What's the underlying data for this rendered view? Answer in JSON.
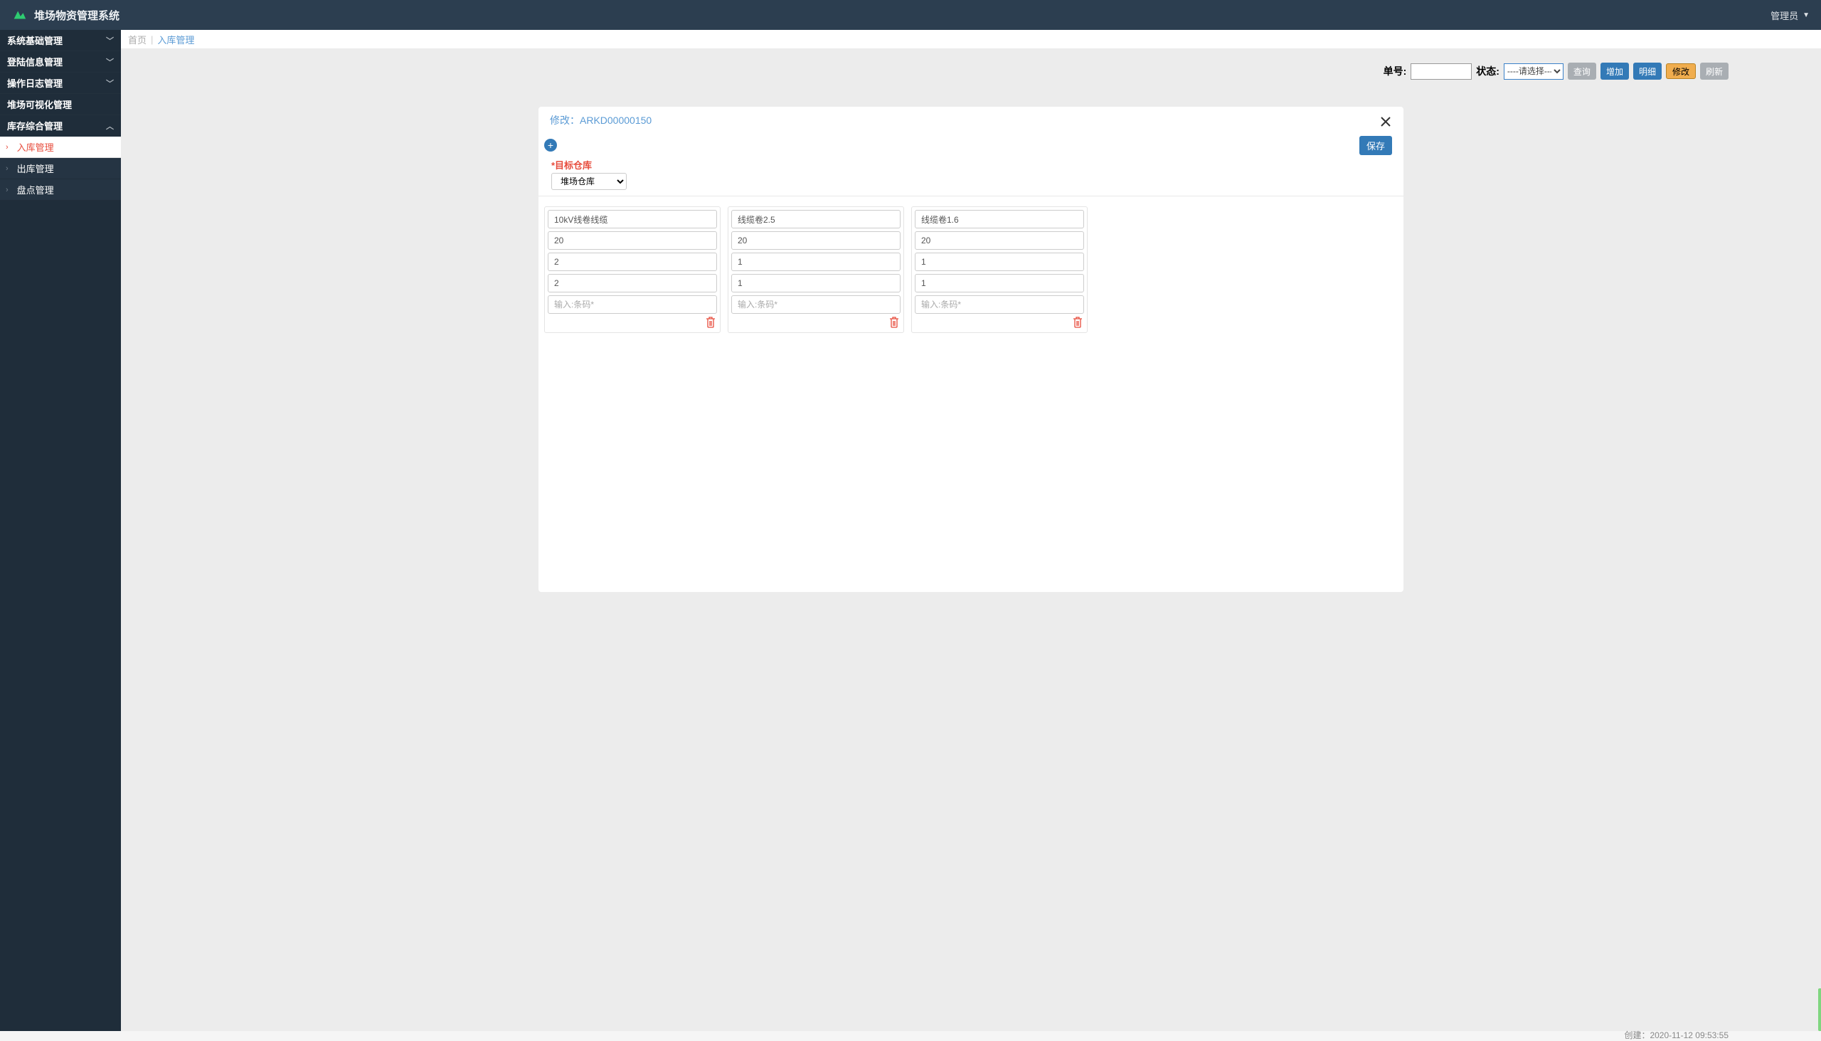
{
  "header": {
    "title": "堆场物资管理系统",
    "user": "管理员"
  },
  "sidebar": {
    "items": [
      {
        "label": "系统基础管理",
        "expanded": false
      },
      {
        "label": "登陆信息管理",
        "expanded": false
      },
      {
        "label": "操作日志管理",
        "expanded": false
      },
      {
        "label": "堆场可视化管理",
        "expanded": false,
        "leaf": true
      },
      {
        "label": "库存综合管理",
        "expanded": true
      }
    ],
    "subitems": [
      {
        "label": "入库管理",
        "active": true
      },
      {
        "label": "出库管理",
        "active": false
      },
      {
        "label": "盘点管理",
        "active": false
      }
    ]
  },
  "breadcrumb": {
    "home": "首页",
    "current": "入库管理"
  },
  "filterbar": {
    "label_order": "单号:",
    "label_status": "状态:",
    "status_placeholder": "----请选择----",
    "btn_query": "查询",
    "btn_add": "增加",
    "btn_detail": "明细",
    "btn_edit": "修改",
    "btn_refresh": "刷新"
  },
  "page_footer": {
    "created_hint": "创建：2020-11-12 09:53:55"
  },
  "modal": {
    "title": "修改：ARKD00000150",
    "save": "保存",
    "target_label": "*目标仓库",
    "target_select": "堆场仓库",
    "barcode_placeholder": "输入:条码*",
    "cards": [
      {
        "name": "10kV线卷线缆",
        "v1": "20",
        "v2": "2",
        "v3": "2"
      },
      {
        "name": "线缆卷2.5",
        "v1": "20",
        "v2": "1",
        "v3": "1"
      },
      {
        "name": "线缆卷1.6",
        "v1": "20",
        "v2": "1",
        "v3": "1"
      }
    ]
  }
}
